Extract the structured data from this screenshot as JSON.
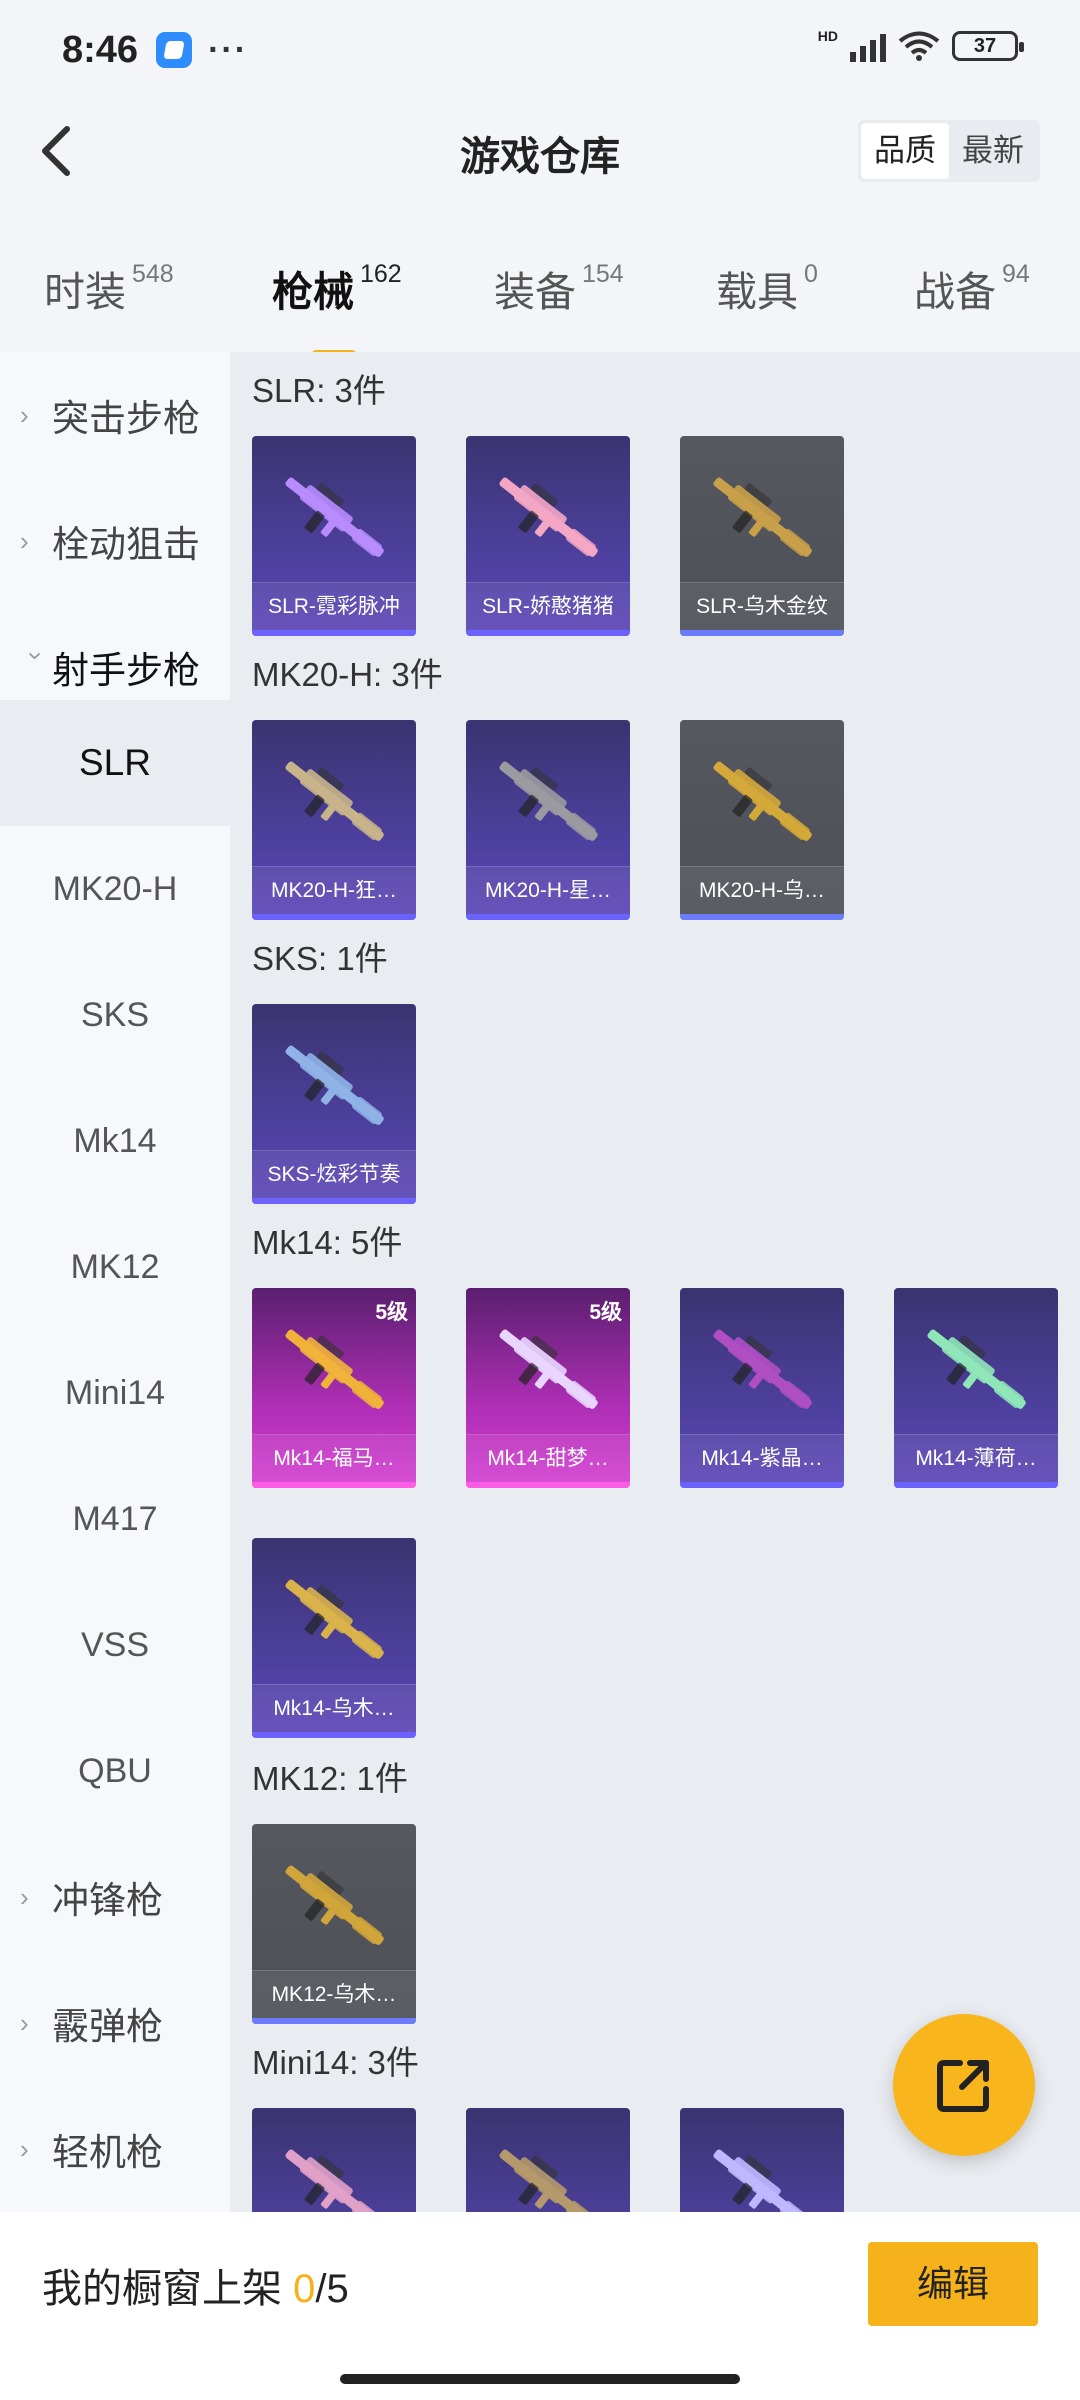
{
  "status": {
    "time": "8:46",
    "battery": "37",
    "network": "HD"
  },
  "header": {
    "title": "游戏仓库",
    "sort": [
      "品质",
      "最新"
    ],
    "sort_active": 0
  },
  "tabs": [
    {
      "label": "时装",
      "count": "548"
    },
    {
      "label": "枪械",
      "count": "162"
    },
    {
      "label": "装备",
      "count": "154"
    },
    {
      "label": "载具",
      "count": "0"
    },
    {
      "label": "战备",
      "count": "94"
    }
  ],
  "sidebar": {
    "cat1": "突击步枪",
    "cat2": "栓动狙击",
    "cat3": "射手步枪",
    "sub": [
      "SLR",
      "MK20-H",
      "SKS",
      "Mk14",
      "MK12",
      "Mini14",
      "M417",
      "VSS",
      "QBU"
    ],
    "cat4": "冲锋枪",
    "cat5": "霰弹枪",
    "cat6": "轻机枪"
  },
  "sections": [
    {
      "title": "SLR: 3件",
      "items": [
        {
          "name": "SLR-霓彩脉冲",
          "tone": "purple",
          "gun": "#b88cff"
        },
        {
          "name": "SLR-娇憨猪猪",
          "tone": "purple",
          "gun": "#f4a7c4"
        },
        {
          "name": "SLR-乌木金纹",
          "tone": "gray",
          "gun": "#c9a04a"
        }
      ]
    },
    {
      "title": "MK20-H: 3件",
      "items": [
        {
          "name": "MK20-H-狂…",
          "tone": "purple",
          "gun": "#c7b48a"
        },
        {
          "name": "MK20-H-星…",
          "tone": "purple",
          "gun": "#9a9aa0"
        },
        {
          "name": "MK20-H-乌…",
          "tone": "gray",
          "gun": "#d4a93a"
        }
      ]
    },
    {
      "title": "SKS: 1件",
      "items": [
        {
          "name": "SKS-炫彩节奏",
          "tone": "purple",
          "gun": "#8fb3e6"
        }
      ]
    },
    {
      "title": "Mk14: 5件",
      "items": [
        {
          "name": "Mk14-福马…",
          "tone": "pink",
          "level": "5级",
          "gun": "#f1b23a"
        },
        {
          "name": "Mk14-甜梦…",
          "tone": "pink",
          "level": "5级",
          "gun": "#e9d6ff"
        },
        {
          "name": "Mk14-紫晶…",
          "tone": "purple",
          "gun": "#b04fc4"
        },
        {
          "name": "Mk14-薄荷…",
          "tone": "purple",
          "gun": "#8fe6b8"
        },
        {
          "name": "Mk14-乌木…",
          "tone": "purple",
          "gun": "#d9b34a"
        }
      ]
    },
    {
      "title": "MK12: 1件",
      "items": [
        {
          "name": "MK12-乌木…",
          "tone": "gray",
          "gun": "#d0a53a"
        }
      ]
    },
    {
      "title": "Mini14: 3件",
      "items": [
        {
          "name": "",
          "tone": "purple",
          "gun": "#e0a0c8"
        },
        {
          "name": "",
          "tone": "purple",
          "gun": "#b49a6a"
        },
        {
          "name": "",
          "tone": "purple",
          "gun": "#c0b8ff"
        }
      ]
    }
  ],
  "bottom": {
    "label": "我的橱窗上架 ",
    "current": "0",
    "total": "/5",
    "edit": "编辑"
  },
  "colors": {
    "accent": "#f6b21a",
    "purple_card": "#4c3f9a",
    "gray_card": "#4d4f56",
    "pink_card": "#c03ac4"
  }
}
